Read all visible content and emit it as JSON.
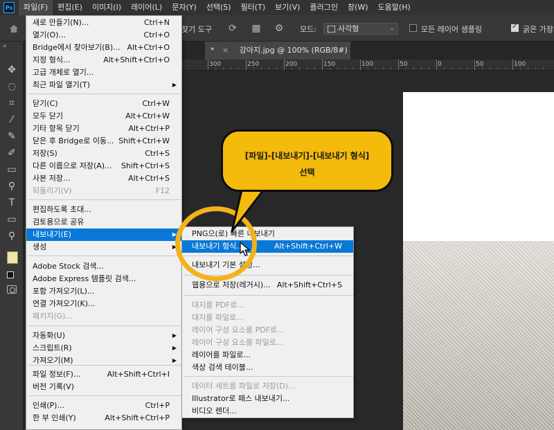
{
  "menubar": {
    "logo": "Ps",
    "items": [
      "파일(F)",
      "편집(E)",
      "이미지(I)",
      "레이어(L)",
      "문자(Y)",
      "선택(S)",
      "필터(T)",
      "보기(V)",
      "플러그인",
      "창(W)",
      "도움말(H)"
    ],
    "active_index": 0
  },
  "options": {
    "tool_name_fragment": "찾기 도구",
    "mode_label": "모드:",
    "mode_value": "사각형",
    "sample_all_layers": "모든 레이어 샘플링",
    "hard_edge": "굵은 가장자리"
  },
  "document": {
    "tab_title": "강아지.jpg @ 100% (RGB/8#)",
    "tab_modified_marker": "*",
    "tab_close": "×",
    "ruler_labels": [
      "300",
      "250",
      "200",
      "150",
      "100",
      "50",
      "0",
      "50",
      "100"
    ]
  },
  "file_menu": {
    "items": [
      {
        "label": "새로 만들기(N)...",
        "shortcut": "Ctrl+N"
      },
      {
        "label": "열기(O)...",
        "shortcut": "Ctrl+O"
      },
      {
        "label": "Bridge에서 찾아보기(B)...",
        "shortcut": "Alt+Ctrl+O"
      },
      {
        "label": "지정 형식...",
        "shortcut": "Alt+Shift+Ctrl+O"
      },
      {
        "label": "고급 개체로 열기..."
      },
      {
        "label": "최근 파일 열기(T)",
        "submenu": true
      },
      {
        "label": "닫기(C)",
        "shortcut": "Ctrl+W"
      },
      {
        "label": "모두 닫기",
        "shortcut": "Alt+Ctrl+W"
      },
      {
        "label": "기타 항목 닫기",
        "shortcut": "Alt+Ctrl+P"
      },
      {
        "label": "닫은 후 Bridge로 이동...",
        "shortcut": "Shift+Ctrl+W"
      },
      {
        "label": "저장(S)",
        "shortcut": "Ctrl+S"
      },
      {
        "label": "다른 이름으로 저장(A)...",
        "shortcut": "Shift+Ctrl+S"
      },
      {
        "label": "사본 저장...",
        "shortcut": "Alt+Ctrl+S"
      },
      {
        "label": "되돌리기(V)",
        "shortcut": "F12",
        "disabled": true
      },
      {
        "label": "편집하도록 초대..."
      },
      {
        "label": "검토용으로 공유"
      },
      {
        "label": "내보내기(E)",
        "submenu": true,
        "highlight": true
      },
      {
        "label": "생성",
        "submenu": true
      },
      {
        "label": "Adobe Stock 검색..."
      },
      {
        "label": "Adobe Express 템플릿 검색..."
      },
      {
        "label": "포함 가져오기(L)..."
      },
      {
        "label": "연결 가져오기(K)..."
      },
      {
        "label": "패키지(G)...",
        "disabled": true
      },
      {
        "label": "자동화(U)",
        "submenu": true
      },
      {
        "label": "스크립트(R)",
        "submenu": true
      },
      {
        "label": "가져오기(M)",
        "submenu": true
      },
      {
        "label": "파일 정보(F)...",
        "shortcut": "Alt+Shift+Ctrl+I"
      },
      {
        "label": "버전 기록(V)"
      },
      {
        "label": "인쇄(P)...",
        "shortcut": "Ctrl+P"
      },
      {
        "label": "한 부 인쇄(Y)",
        "shortcut": "Alt+Shift+Ctrl+P"
      }
    ]
  },
  "export_menu": {
    "items": [
      {
        "label": "PNG으(로) 빠른 내보내기"
      },
      {
        "label": "내보내기 형식...",
        "shortcut": "Alt+Shift+Ctrl+W",
        "highlight": true
      },
      {
        "label": "내보내기 기본 설정..."
      },
      {
        "label": "웹용으로 저장(레거시)...",
        "shortcut": "Alt+Shift+Ctrl+S"
      },
      {
        "label": "대지를 PDF로...",
        "disabled": true
      },
      {
        "label": "대지를 파일로...",
        "disabled": true
      },
      {
        "label": "레이어 구성 요소를 PDF로...",
        "disabled": true
      },
      {
        "label": "레이어 구성 요소를 파일로...",
        "disabled": true
      },
      {
        "label": "레이어를 파일로..."
      },
      {
        "label": "색상 검색 테이블..."
      },
      {
        "label": "데이터 세트를 파일로 저장(D)...",
        "disabled": true
      },
      {
        "label": "Illustrator로 패스 내보내기..."
      },
      {
        "label": "비디오 렌더..."
      }
    ]
  },
  "callout": {
    "line1": "[파일]-[내보내기]-[내보내기 형식]",
    "line2": "선택"
  },
  "colors": {
    "highlight": "#0a78d7",
    "callout": "#f4ba0c",
    "ring": "#f2b21a",
    "foreground_swatch": "#ede7a1"
  }
}
